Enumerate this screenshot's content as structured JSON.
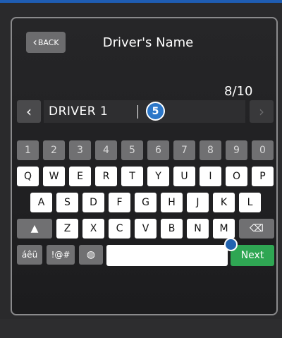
{
  "header": {
    "back_label": "BACK",
    "title": "Driver's Name"
  },
  "counter": "8/10",
  "input": {
    "value": "DRIVER 1",
    "step_badge": "5"
  },
  "icons": {
    "left_arrow": "chevron-left-icon",
    "right_arrow": "chevron-right-icon",
    "clear": "close-icon",
    "shift": "shift-icon",
    "backspace": "backspace-icon",
    "globe": "globe-icon"
  },
  "keyboard": {
    "numbers": [
      "1",
      "2",
      "3",
      "4",
      "5",
      "6",
      "7",
      "8",
      "9",
      "0"
    ],
    "row1": [
      "Q",
      "W",
      "E",
      "R",
      "T",
      "Y",
      "U",
      "I",
      "O",
      "P"
    ],
    "row2": [
      "A",
      "S",
      "D",
      "F",
      "G",
      "H",
      "J",
      "K",
      "L"
    ],
    "row3": [
      "Z",
      "X",
      "C",
      "V",
      "B",
      "N",
      "M"
    ],
    "accent_key": "áêü",
    "symbol_key": "!@#",
    "next_label": "Next"
  },
  "colors": {
    "next": "#2fa653",
    "badge": "#2c77c8",
    "top_band": "#1f5db3"
  }
}
